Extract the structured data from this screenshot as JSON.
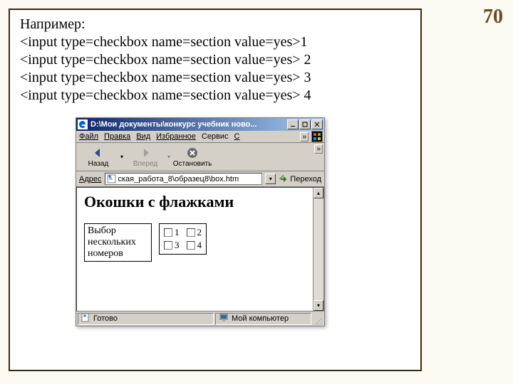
{
  "slide_number": "70",
  "code": {
    "intro": "Например:",
    "lines": [
      "<input type=checkbox name=section value=yes>1",
      "<input type=checkbox name=section value=yes> 2",
      "<input type=checkbox name=section value=yes> 3",
      "<input type=checkbox name=section value=yes> 4"
    ]
  },
  "browser": {
    "title": "D:\\Мои документы\\конкурс учебник ново...",
    "menu": {
      "file": "Файл",
      "edit": "Правка",
      "view": "Вид",
      "favorites": "Избранное",
      "tools": "Сервис",
      "help": "С"
    },
    "toolbar": {
      "back": "Назад",
      "forward": "Вперед",
      "stop": "Остановить"
    },
    "address": {
      "label": "Адрес",
      "value": "ская_работа_8\\образец8\\box.htm",
      "go": "Переход"
    },
    "page": {
      "heading": "Окошки с флажками",
      "form_label": "Выбор нескольких номеров",
      "cb": [
        "1",
        "2",
        "3",
        "4"
      ]
    },
    "status": {
      "ready": "Готово",
      "zone": "Мой компьютер"
    }
  }
}
